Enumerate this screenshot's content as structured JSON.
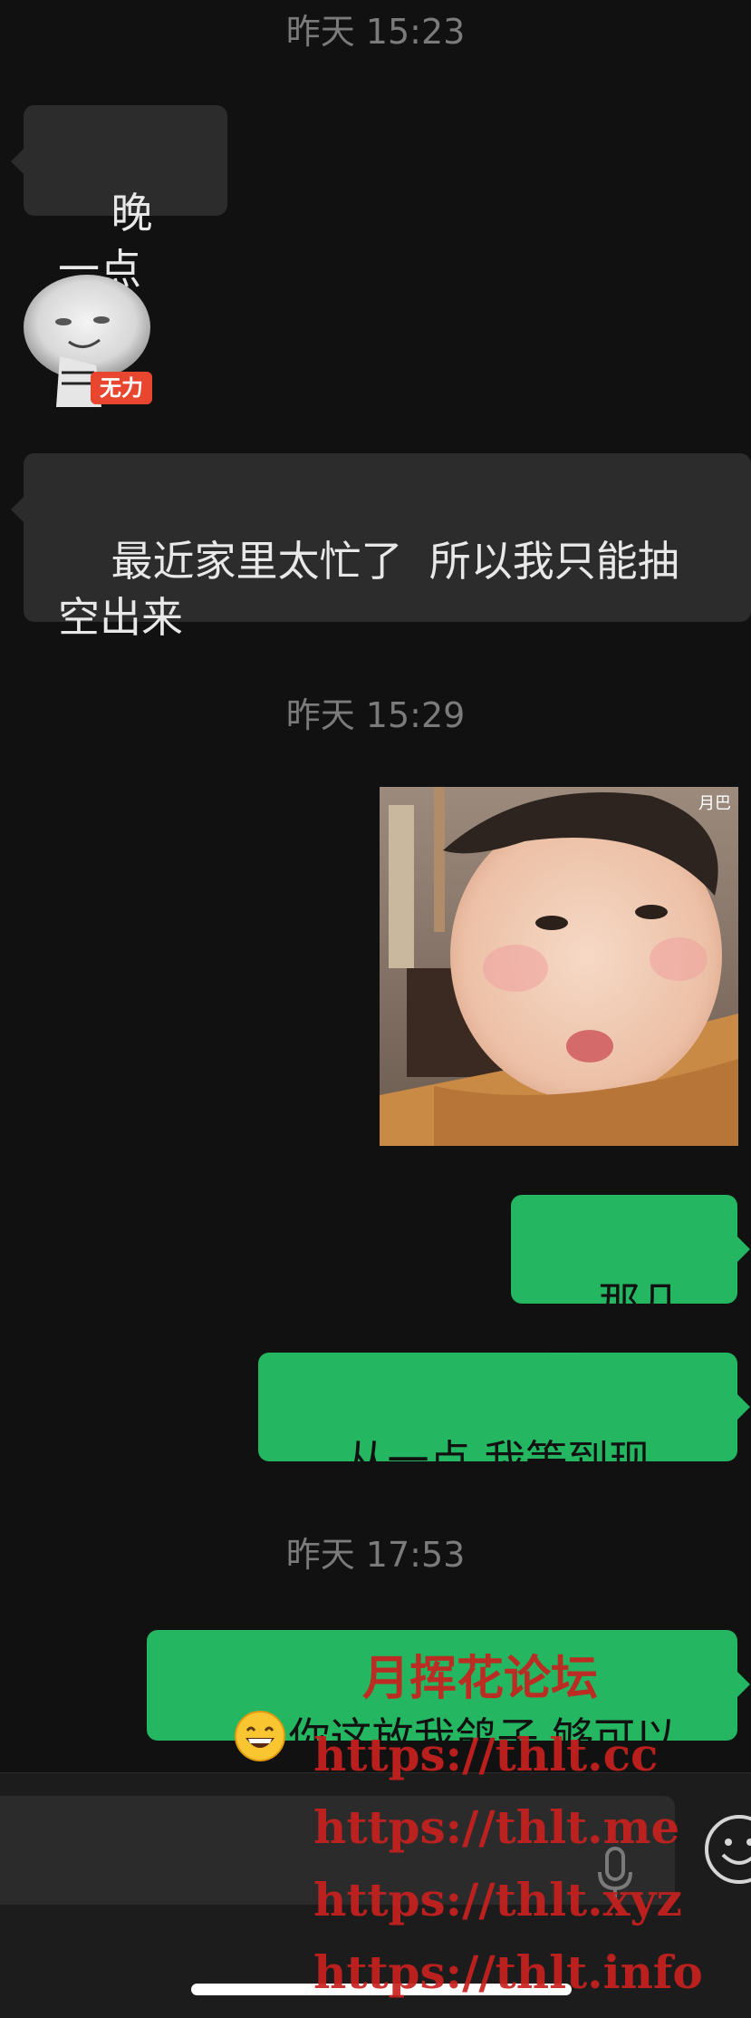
{
  "timestamps": [
    "昨天 15:23",
    "昨天 15:29",
    "昨天 17:53"
  ],
  "messages": {
    "m1": "晚一点",
    "sticker_badge": "无力",
    "m2": "最近家里太忙了  所以我只能抽空出来",
    "photo_watermark": "月巴",
    "m3": "那几点?",
    "m4": "从一点 我等到现在...",
    "m5_emoji": "grinning-face-emoji",
    "m5": "你这放我鸽子 够可以的"
  },
  "overlay": {
    "title": "月挥花论坛",
    "links": [
      "https://thlt.cc",
      "https://thlt.me",
      "https://thlt.xyz",
      "https://thlt.info"
    ]
  },
  "input_bar": {
    "mic_icon": "microphone-icon",
    "emoji_icon": "smiley-icon"
  },
  "colors": {
    "background": "#111111",
    "incoming_bubble": "#2c2c2c",
    "outgoing_bubble": "#25b661",
    "timestamp": "#7b7b7b",
    "watermark_red": "#c8211e"
  }
}
